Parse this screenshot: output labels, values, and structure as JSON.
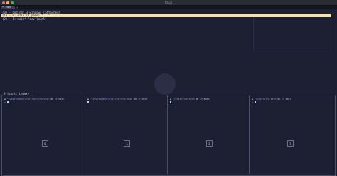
{
  "window": {
    "title": "tmux"
  },
  "tabs": [
    {
      "label": "• tmux"
    }
  ],
  "tab_add": "+",
  "chooser": {
    "header": "(0) - Coding: 3 windows (attached)",
    "selected": "(1) - 0: main (1 pane) \"...\"",
    "item": "(2) - 1: main* \"dev-local\""
  },
  "bottom_title": "0 (sort: index)",
  "panes": [
    {
      "path": "~/Development/rust/service-mesh",
      "branch": "main",
      "second": "→",
      "index": "0"
    },
    {
      "path": "~/Development/rust/service-mesh",
      "branch": "main",
      "second": "",
      "index": "1"
    },
    {
      "path": "~/w/service-mesh",
      "branch": "main",
      "second": "",
      "index": "2"
    },
    {
      "path": "~/w/service-mesh",
      "branch": "main",
      "second": "→",
      "index": "3"
    }
  ],
  "prompt_on": "on",
  "branch_icon": "⎇",
  "colors": {
    "background": "#1d2033",
    "selected_bg": "#f3e2b5",
    "border": "#4a4e66"
  }
}
